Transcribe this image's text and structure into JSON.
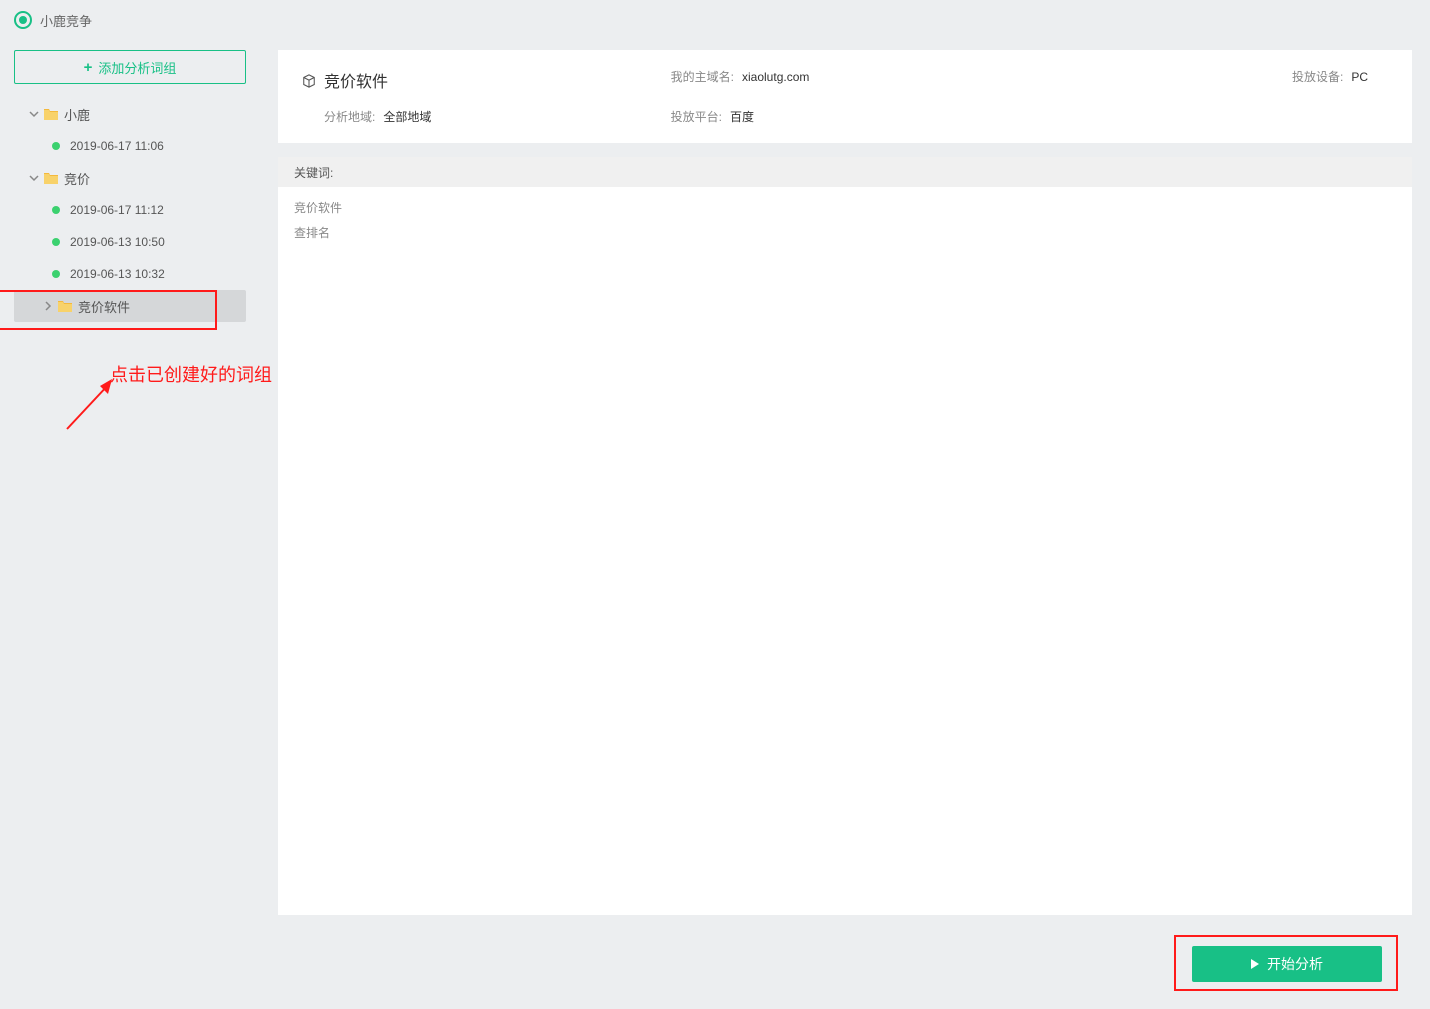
{
  "header": {
    "appTitle": "小鹿竞争"
  },
  "sidebar": {
    "addButtonLabel": "添加分析词组",
    "tree": [
      {
        "label": "小鹿",
        "expanded": true,
        "children": [
          {
            "label": "2019-06-17 11:06"
          }
        ]
      },
      {
        "label": "竞价",
        "expanded": true,
        "children": [
          {
            "label": "2019-06-17 11:12"
          },
          {
            "label": "2019-06-13 10:50"
          },
          {
            "label": "2019-06-13 10:32"
          }
        ]
      }
    ],
    "selectedNode": {
      "label": "竞价软件"
    },
    "annotation": "点击已创建好的词组"
  },
  "main": {
    "title": "竞价软件",
    "domainLabel": "我的主域名:",
    "domainValue": "xiaolutg.com",
    "deviceLabel": "投放设备:",
    "deviceValue": "PC",
    "regionLabel": "分析地域:",
    "regionValue": "全部地域",
    "platformLabel": "投放平台:",
    "platformValue": "百度",
    "keywordsHeader": "关键词:",
    "keywords": [
      "竞价软件",
      "查排名"
    ],
    "startButtonLabel": "开始分析"
  }
}
